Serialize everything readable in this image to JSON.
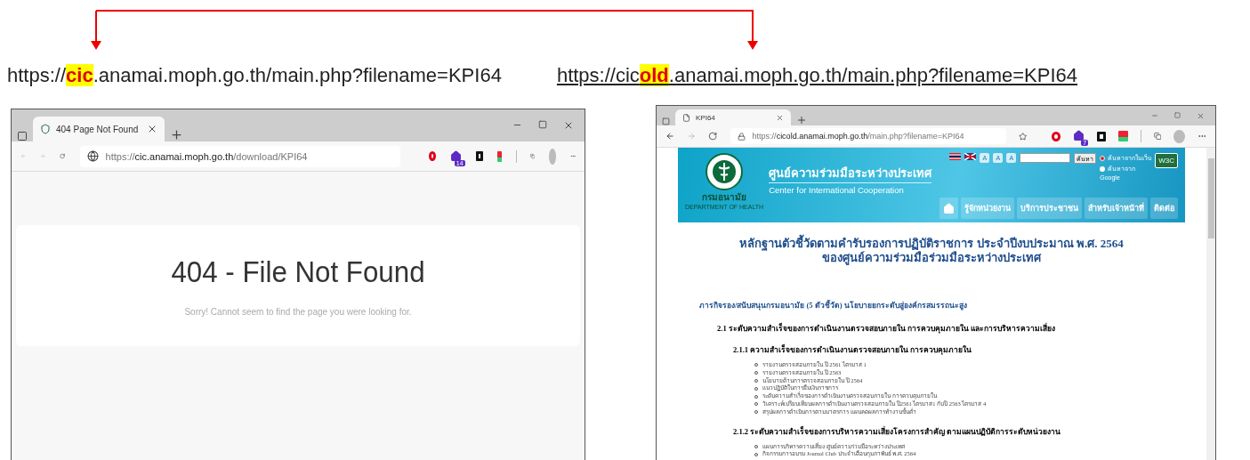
{
  "annotation": {
    "labels": [
      {
        "underlined": false,
        "parts": [
          {
            "text": "https://",
            "highlight": false
          },
          {
            "text": "cic",
            "highlight": true
          },
          {
            "text": ".anamai.moph.go.th/main.php?filename=KPI64",
            "highlight": false
          }
        ]
      },
      {
        "underlined": true,
        "parts": [
          {
            "text": "https://cic",
            "highlight": false
          },
          {
            "text": "old",
            "highlight": true
          },
          {
            "text": ".anamai.moph.go.th/main.php?filename=KPI64",
            "highlight": false
          }
        ]
      }
    ]
  },
  "browsers": [
    {
      "tab": {
        "title": "404 Page Not Found"
      },
      "back_enabled": false,
      "address": {
        "scheme": "https://",
        "host": "cic.anamai.moph.go.th",
        "path": "/download/KPI64",
        "secure": false
      },
      "extension_badge": "14",
      "page": {
        "kind": "error",
        "heading": "404 - File Not Found",
        "message": "Sorry! Cannot seem to find the page you were looking for."
      }
    },
    {
      "tab": {
        "title": "KPI64"
      },
      "back_enabled": true,
      "address": {
        "scheme": "https://",
        "host": "cicold.anamai.moph.go.th",
        "path": "/main.php?filename=KPI64",
        "secure": true
      },
      "extension_badge": "7",
      "page": {
        "kind": "site",
        "org": "กรมอนามัย",
        "org_en": "DEPARTMENT OF HEALTH",
        "title": "ศูนย์ความร่วมมือระหว่างประเทศ",
        "subtitle": "Center for International Cooperation",
        "font_buttons": [
          "A",
          "A",
          "A"
        ],
        "search_button": "ค้นหา",
        "search_options": [
          {
            "label": "ค้นหาจากในเว็บ",
            "selected": true
          },
          {
            "label": "ค้นหาจาก",
            "selected": false
          }
        ],
        "search_google": "Google",
        "badge": "W3C",
        "nav": [
          {
            "kind": "home"
          },
          {
            "kind": "text",
            "label": "รู้จักหน่วยงาน"
          },
          {
            "kind": "text",
            "label": "บริการประชาชน"
          },
          {
            "kind": "text",
            "label": "สำหรับเจ้าหน้าที่"
          },
          {
            "kind": "text",
            "label": "ติดต่อ"
          }
        ],
        "heading": [
          "หลักฐานตัวชี้วัดตามคำรับรองการปฏิบัติราชการ ประจำปีงบประมาณ พ.ศ. 2564",
          "ของศูนย์ความร่วมมือร่วมมือระหว่างประเทศ"
        ],
        "mission": "ภารกิจรอง/สนับสนุนกรมอนามัย (5 ตัวชี้วัด) นโยบายยกระดับสู่องค์กรสมรรถนะสูง",
        "section": {
          "title": "2.1 ระดับความสำเร็จของการดำเนินงานตรวจสอบภายใน การควบคุมภายใน และการบริหารความเสี่ยง",
          "children": [
            {
              "title": "2.1.1 ความสำเร็จของการดำเนินงานตรวจสอบภายใน การควบคุมภายใน",
              "items": [
                "รายงานตรวจสอบภายใน ปี 2561 ไตรมาส 1",
                "รายงานตรวจสอบภายใน ปี 2563",
                "นโยบายด้านการตรวจสอบภายใน ปี 2564",
                "แนวปฏิบัติในการยืมเงินราชการ",
                "ระดับความสำเร็จของการดำเนินงานตรวจสอบภายใน การควบคุมภายใน",
                "วิเคราะห์เปรียบเทียบผลการดำเนินงานตรวจสอบภายใน ปี2561 ไตรมาส1 กับปี 2563 ไตรมาส 4",
                "สรุปผลการดำเนินการตามมาตรการ แผนลดผลการทำงานขั้นต่ำ"
              ]
            },
            {
              "title": "2.1.2 ระดับความสำเร็จของการบริหารความเสี่ยงโครงการสำคัญ ตามแผนปฏิบัติการระดับหน่วยงาน",
              "items": [
                "แผนการบริหารความเสี่ยง ศูนย์ความร่วมมือระหว่างประเทศ",
                "กิจกรรมการอบรม Journal Club ประจำเดือนกุมภาพันธ์ พ.ศ. 2564"
              ]
            }
          ]
        }
      }
    }
  ]
}
